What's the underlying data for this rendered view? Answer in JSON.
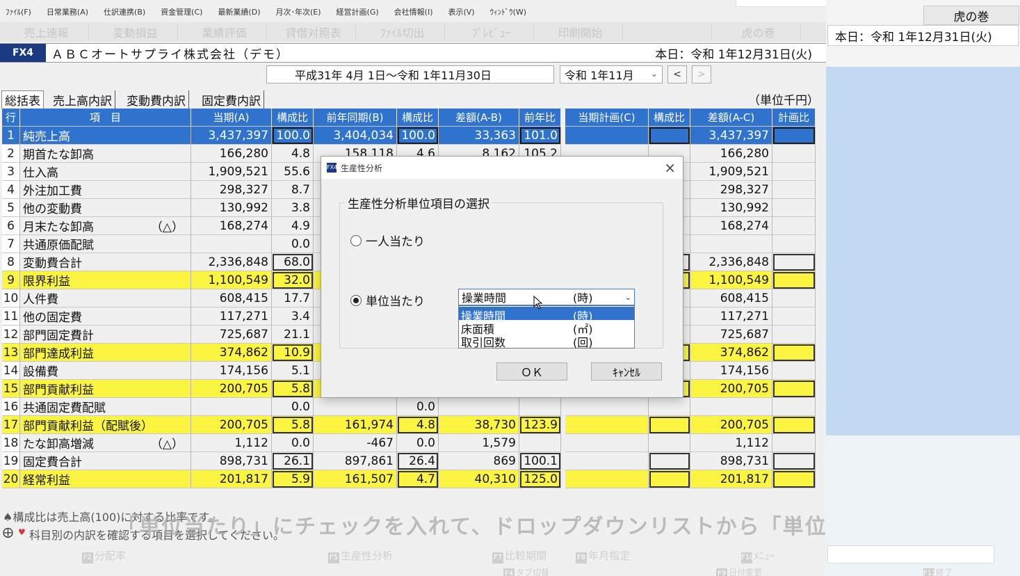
{
  "menu": [
    "ﾌｧｲﾙ(F)",
    "日常業務(A)",
    "仕訳連携(B)",
    "資金管理(C)",
    "最新業績(D)",
    "月次･年次(E)",
    "経営計画(G)",
    "会社情報(I)",
    "表示(V)",
    "ｳｨﾝﾄﾞｳ(W)"
  ],
  "toolbar": [
    "売上速報",
    "変動損益",
    "業績評価",
    "貸借対照表",
    "ﾌｧｲﾙ切出",
    "ﾌﾟﾚﾋﾞｭｰ",
    "印刷開始",
    "",
    "虎の巻"
  ],
  "title": {
    "badge": "FX4",
    "company": "ＡＢＣオートサプライ株式会社（デモ）",
    "today": "本日：令和 1年12月31日(火)"
  },
  "period": {
    "range": "平成31年 4月 1日～令和 1年11月30日",
    "month": "令和 1年11月",
    "prev": "<",
    "next": ">"
  },
  "tabs": [
    "総括表",
    "売上高内訳",
    "変動費内訳",
    "固定費内訳"
  ],
  "unit_label": "（単位千円）",
  "table": {
    "headers": [
      "行",
      "項　目",
      "当期(A)",
      "構成比",
      "前年同期(B)",
      "構成比",
      "差額(A-B)",
      "前年比",
      "当期計画(C)",
      "構成比",
      "差額(A-C)",
      "計画比"
    ],
    "rows": [
      {
        "no": "1",
        "item": "純売上高",
        "mark": "",
        "a": "3,437,397",
        "ra": "100.0",
        "b": "3,404,034",
        "rb": "100.0",
        "ab": "33,363",
        "yoy": "101.0",
        "c": "",
        "rc": "",
        "ac": "3,437,397",
        "pc": "",
        "style": "blue"
      },
      {
        "no": "2",
        "item": "期首たな卸高",
        "mark": "",
        "a": "166,280",
        "ra": "4.8",
        "b": "158,118",
        "rb": "4.6",
        "ab": "8,162",
        "yoy": "105.2",
        "c": "",
        "rc": "",
        "ac": "166,280",
        "pc": "",
        "style": ""
      },
      {
        "no": "3",
        "item": "仕入高",
        "mark": "",
        "a": "1,909,521",
        "ra": "55.6",
        "b": "",
        "rb": "",
        "ab": "",
        "yoy": "",
        "c": "",
        "rc": "",
        "ac": "1,909,521",
        "pc": "",
        "style": ""
      },
      {
        "no": "4",
        "item": "外注加工費",
        "mark": "",
        "a": "298,327",
        "ra": "8.7",
        "b": "",
        "rb": "",
        "ab": "",
        "yoy": "",
        "c": "",
        "rc": "",
        "ac": "298,327",
        "pc": "",
        "style": ""
      },
      {
        "no": "5",
        "item": "他の変動費",
        "mark": "",
        "a": "130,992",
        "ra": "3.8",
        "b": "",
        "rb": "",
        "ab": "",
        "yoy": "",
        "c": "",
        "rc": "",
        "ac": "130,992",
        "pc": "",
        "style": ""
      },
      {
        "no": "6",
        "item": "月末たな卸高",
        "mark": "（△）",
        "a": "168,274",
        "ra": "4.9",
        "b": "",
        "rb": "",
        "ab": "",
        "yoy": "",
        "c": "",
        "rc": "",
        "ac": "168,274",
        "pc": "",
        "style": ""
      },
      {
        "no": "7",
        "item": "共通原価配賦",
        "mark": "",
        "a": "",
        "ra": "0.0",
        "b": "",
        "rb": "",
        "ab": "",
        "yoy": "",
        "c": "",
        "rc": "",
        "ac": "",
        "pc": "",
        "style": ""
      },
      {
        "no": "8",
        "item": "変動費合計",
        "mark": "",
        "a": "2,336,848",
        "ra": "68.0",
        "b": "",
        "rb": "",
        "ab": "",
        "yoy": "",
        "c": "",
        "rc": "",
        "ac": "2,336,848",
        "pc": "",
        "style": "boxed"
      },
      {
        "no": "9",
        "item": "限界利益",
        "mark": "",
        "a": "1,100,549",
        "ra": "32.0",
        "b": "",
        "rb": "",
        "ab": "",
        "yoy": "",
        "c": "",
        "rc": "",
        "ac": "1,100,549",
        "pc": "",
        "style": "yellow"
      },
      {
        "no": "10",
        "item": "人件費",
        "mark": "",
        "a": "608,415",
        "ra": "17.7",
        "b": "",
        "rb": "",
        "ab": "",
        "yoy": "",
        "c": "",
        "rc": "",
        "ac": "608,415",
        "pc": "",
        "style": ""
      },
      {
        "no": "11",
        "item": "他の固定費",
        "mark": "",
        "a": "117,271",
        "ra": "3.4",
        "b": "",
        "rb": "",
        "ab": "",
        "yoy": "",
        "c": "",
        "rc": "",
        "ac": "117,271",
        "pc": "",
        "style": ""
      },
      {
        "no": "12",
        "item": "部門固定費計",
        "mark": "",
        "a": "725,687",
        "ra": "21.1",
        "b": "",
        "rb": "",
        "ab": "",
        "yoy": "",
        "c": "",
        "rc": "",
        "ac": "725,687",
        "pc": "",
        "style": ""
      },
      {
        "no": "13",
        "item": "部門達成利益",
        "mark": "",
        "a": "374,862",
        "ra": "10.9",
        "b": "",
        "rb": "",
        "ab": "",
        "yoy": "",
        "c": "",
        "rc": "",
        "ac": "374,862",
        "pc": "",
        "style": "yellow"
      },
      {
        "no": "14",
        "item": "設備費",
        "mark": "",
        "a": "174,156",
        "ra": "5.1",
        "b": "",
        "rb": "",
        "ab": "",
        "yoy": "",
        "c": "",
        "rc": "",
        "ac": "174,156",
        "pc": "",
        "style": ""
      },
      {
        "no": "15",
        "item": "部門貢献利益",
        "mark": "",
        "a": "200,705",
        "ra": "5.8",
        "b": "",
        "rb": "",
        "ab": "",
        "yoy": "",
        "c": "",
        "rc": "",
        "ac": "200,705",
        "pc": "",
        "style": "yellow"
      },
      {
        "no": "16",
        "item": "共通固定費配賦",
        "mark": "",
        "a": "",
        "ra": "0.0",
        "b": "",
        "rb": "0.0",
        "ab": "",
        "yoy": "",
        "c": "",
        "rc": "",
        "ac": "",
        "pc": "",
        "style": ""
      },
      {
        "no": "17",
        "item": "部門貢献利益（配賦後）",
        "mark": "",
        "a": "200,705",
        "ra": "5.8",
        "b": "161,974",
        "rb": "4.8",
        "ab": "38,730",
        "yoy": "123.9",
        "c": "",
        "rc": "",
        "ac": "200,705",
        "pc": "",
        "style": "yellow"
      },
      {
        "no": "18",
        "item": "たな卸高増減",
        "mark": "（△）",
        "a": "1,112",
        "ra": "0.0",
        "b": "-467",
        "rb": "0.0",
        "ab": "1,579",
        "yoy": "",
        "c": "",
        "rc": "",
        "ac": "1,112",
        "pc": "",
        "style": ""
      },
      {
        "no": "19",
        "item": "固定費合計",
        "mark": "",
        "a": "898,731",
        "ra": "26.1",
        "b": "897,861",
        "rb": "26.4",
        "ab": "869",
        "yoy": "100.1",
        "c": "",
        "rc": "",
        "ac": "898,731",
        "pc": "",
        "style": "boxed"
      },
      {
        "no": "20",
        "item": "経常利益",
        "mark": "",
        "a": "201,817",
        "ra": "5.9",
        "b": "161,507",
        "rb": "4.7",
        "ab": "40,310",
        "yoy": "125.0",
        "c": "",
        "rc": "",
        "ac": "201,817",
        "pc": "",
        "style": "yellow"
      }
    ]
  },
  "footer": {
    "hint1": "♠構成比は売上高(100)に対する比率です。",
    "hint2": "科目別の内訳を確認する項目を選択してください。",
    "caption": "「単位当たり」にチェックを入れて、ドロップダウンリストから「単位」を選ぶ",
    "fkeys": [
      {
        "key": "F2",
        "label": "分配率"
      },
      {
        "key": "F5",
        "label": "生産性分析"
      },
      {
        "key": "F7",
        "label": "比較期間"
      },
      {
        "key": "F8",
        "label": "年月指定"
      },
      {
        "key": "F10",
        "label": "ﾒﾆｭｰ"
      }
    ],
    "fkeys_row2": [
      {
        "key": "F4",
        "label": "タブ切替"
      },
      {
        "key": "F9",
        "label": "日付変更"
      },
      {
        "key": "F12",
        "label": "終了"
      }
    ]
  },
  "side": {
    "tiger": "虎の巻",
    "date": "本日：令和 1年12月31日(火)"
  },
  "dialog": {
    "icon": "FX4",
    "title": "生産性分析",
    "close": "×",
    "group_title": "生産性分析単位項目の選択",
    "radio_person": "一人当たり",
    "radio_unit": "単位当たり",
    "selected_unit": {
      "name": "操業時間",
      "unit": "(時)"
    },
    "options": [
      {
        "name": "操業時間",
        "unit": "(時)"
      },
      {
        "name": "床面積",
        "unit": "(㎡)"
      },
      {
        "name": "取引回数",
        "unit": "(回)"
      }
    ],
    "ok": "ＯＫ",
    "cancel": "ｷｬﾝｾﾙ"
  }
}
